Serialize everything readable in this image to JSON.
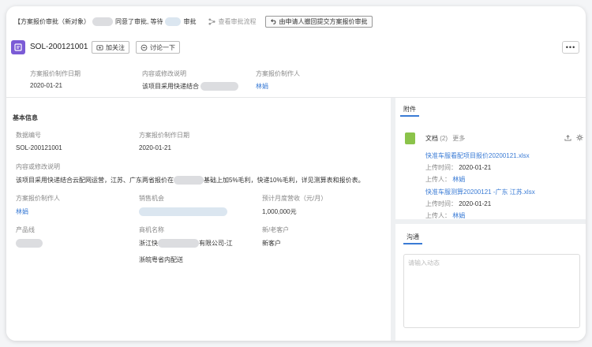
{
  "banner": {
    "prefix": "【方案报价审批（新对象）",
    "mid1": "同意了审批, 等待",
    "mid2": "审批",
    "flow_label": "查看审批流程",
    "withdraw_label": "由申请人撤回提交方案报价审批"
  },
  "header": {
    "title": "SOL-200121001",
    "follow_label": "加关注",
    "discuss_label": "讨论一下",
    "more_label": "•••",
    "fields": [
      {
        "label": "方案报价制作日期",
        "value": "2020-01-21"
      },
      {
        "label": "内容或修改说明",
        "value": "该项目采用快递结合"
      },
      {
        "label": "方案报价制作人",
        "value": "林娟"
      }
    ]
  },
  "basic": {
    "heading": "基本信息",
    "number_label": "数据编号",
    "number_value": "SOL-200121001",
    "date_label": "方案报价制作日期",
    "date_value": "2020-01-21",
    "desc_label": "内容或修改说明",
    "desc_part1": "该项目采用快递结合云配网运营，江苏、广东两省报价在",
    "desc_part2": "基础上加5%毛利，快递10%毛利，详见测算表和报价表。",
    "maker_label": "方案报价制作人",
    "maker_value": "林娟",
    "opportunity_label": "销售机会",
    "revenue_label": "预计月度营收（元/月）",
    "revenue_value": "1,000,000元",
    "product_label": "产品线",
    "merchant_label": "商机名称",
    "merchant_part1": "浙江快",
    "merchant_part2": "有限公司-江",
    "merchant_line2": "浙皖粤省内配送",
    "customer_label": "新/老客户",
    "customer_value": "新客户"
  },
  "attachments": {
    "tab": "附件",
    "doc_label": "文档",
    "doc_count": "(2)",
    "more_label": "更多",
    "upload_time_label": "上传时间：",
    "uploader_label": "上传人：",
    "files": [
      {
        "name": "快准车服看配项目报价20200121.xlsx",
        "time": "2020-01-21",
        "uploader": "林娟"
      },
      {
        "name": "快准车服测算20200121 -广东 江苏.xlsx",
        "time": "2020-01-21",
        "uploader": "林娟"
      }
    ]
  },
  "communicate": {
    "tab": "沟通",
    "placeholder": "请输入动态"
  }
}
